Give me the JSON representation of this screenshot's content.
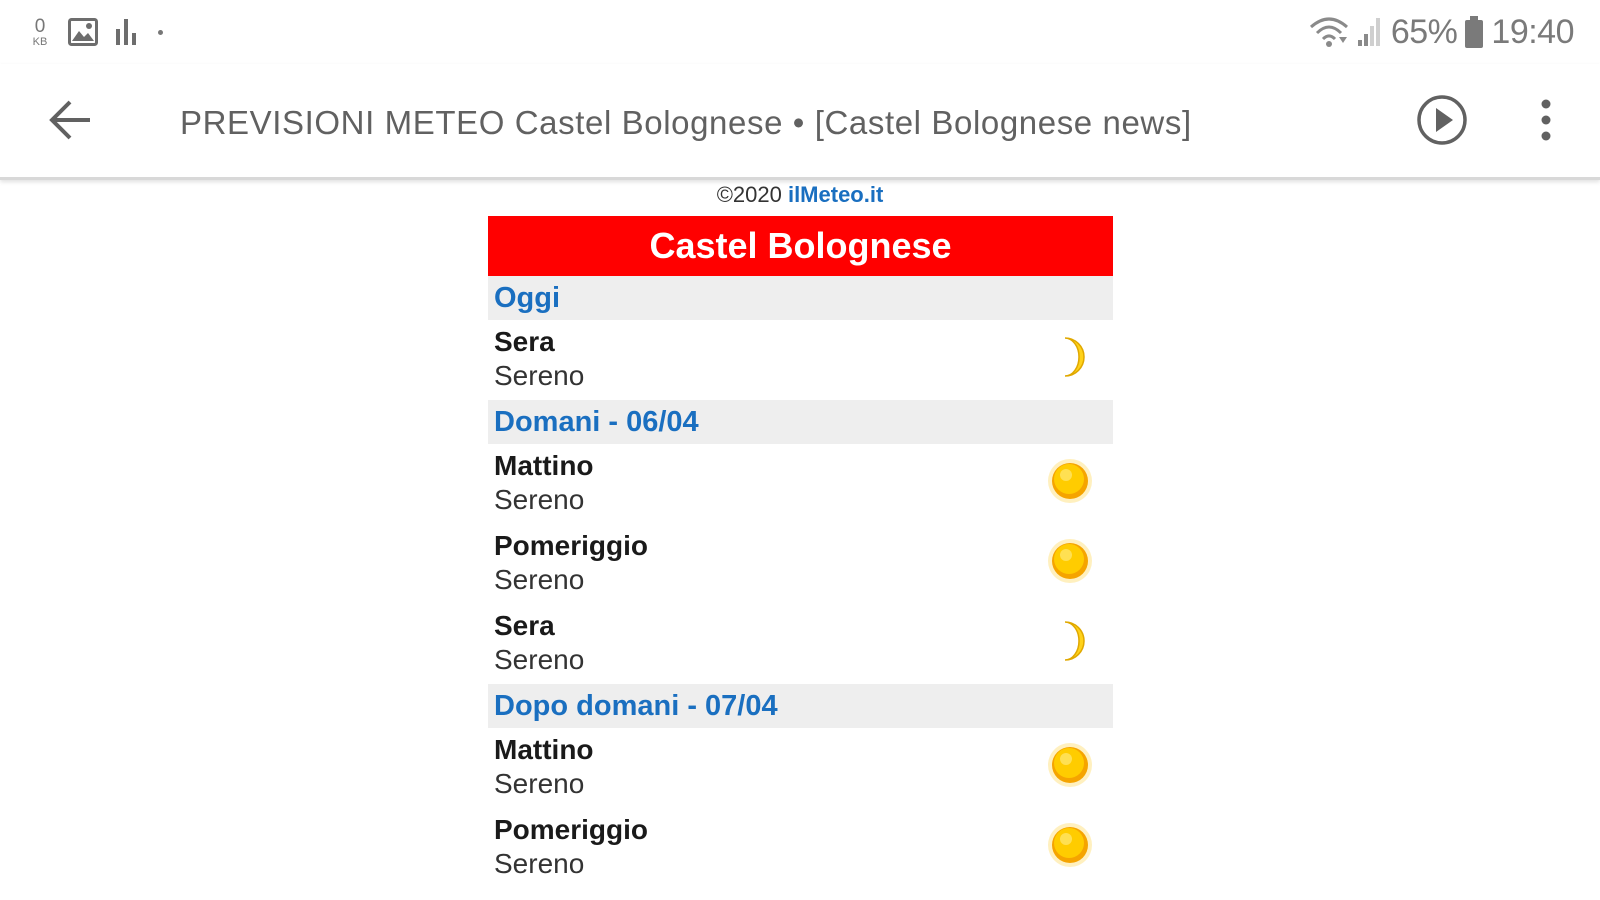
{
  "status_bar": {
    "kb_speed_value": "0",
    "kb_speed_unit": "KB",
    "battery_percent": "65%",
    "time": "19:40"
  },
  "app_bar": {
    "title": "PREVISIONI METEO Castel Bolognese • [Castel Bolognese news]"
  },
  "credit": {
    "prefix": "©2020 ",
    "link_text": "ilMeteo.it"
  },
  "forecast": {
    "city": "Castel Bolognese",
    "days": [
      {
        "label": "Oggi",
        "periods": [
          {
            "name": "Sera",
            "condition": "Sereno",
            "icon": "moon-icon"
          }
        ]
      },
      {
        "label": "Domani - 06/04",
        "periods": [
          {
            "name": "Mattino",
            "condition": "Sereno",
            "icon": "sun-icon"
          },
          {
            "name": "Pomeriggio",
            "condition": "Sereno",
            "icon": "sun-icon"
          },
          {
            "name": "Sera",
            "condition": "Sereno",
            "icon": "moon-icon"
          }
        ]
      },
      {
        "label": "Dopo domani - 07/04",
        "periods": [
          {
            "name": "Mattino",
            "condition": "Sereno",
            "icon": "sun-icon"
          },
          {
            "name": "Pomeriggio",
            "condition": "Sereno",
            "icon": "sun-icon"
          }
        ]
      }
    ]
  },
  "colors": {
    "header_red": "#ff0000",
    "day_link_blue": "#1a6fc0",
    "day_header_bg": "#eeeeee",
    "sun_yellow": "#ffcc00",
    "moon_yellow": "#ffd21a"
  }
}
